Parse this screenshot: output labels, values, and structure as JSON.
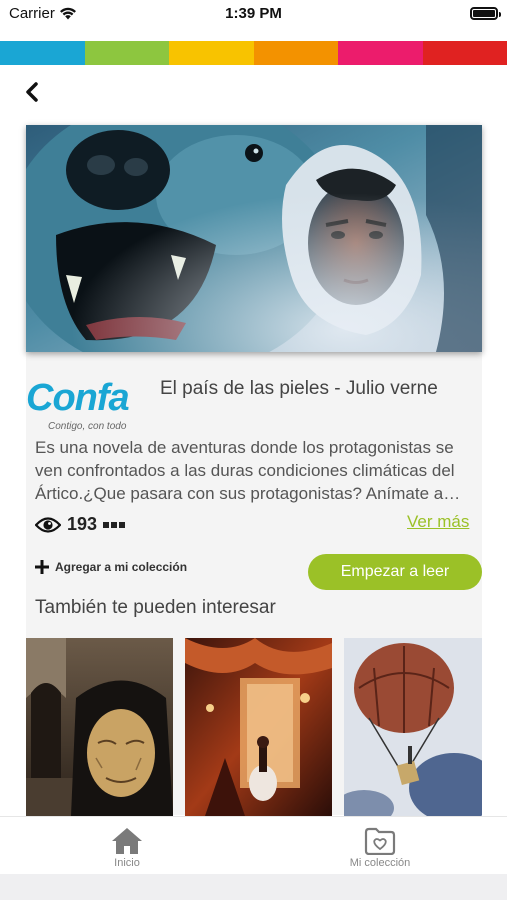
{
  "status_bar": {
    "carrier": "Carrier",
    "time": "1:39 PM"
  },
  "brand_colors": [
    "#1aa6d4",
    "#8dc63f",
    "#f8c300",
    "#f39200",
    "#ec1c6c",
    "#e02221"
  ],
  "accent_color": "#9bc127",
  "nav": {
    "back_icon": "chevron-left-icon"
  },
  "book": {
    "title": "El país de las pieles - Julio verne",
    "description": "Es una novela de aventuras donde los protagonistas se ven confrontados a las duras condiciones climáticas del Ártico.¿Que pasara con sus protagonistas? Anímate a…",
    "views": "193",
    "see_more": "Ver más",
    "add_to_collection": "Agregar a mi colección",
    "start_reading": "Empezar a leer"
  },
  "logo": {
    "name": "Confa",
    "tagline": "Contigo, con todo"
  },
  "related": {
    "heading": "También te pueden interesar"
  },
  "tabs": [
    {
      "label": "Inicio",
      "icon": "home-icon"
    },
    {
      "label": "Mi colección",
      "icon": "folder-heart-icon"
    }
  ]
}
